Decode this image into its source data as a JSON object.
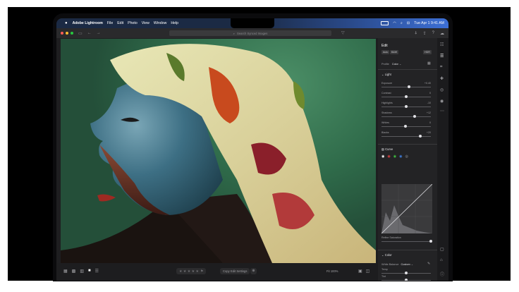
{
  "menubar": {
    "apple": "",
    "app_name": "Adobe Lightroom",
    "items": [
      "File",
      "Edit",
      "Photo",
      "View",
      "Window",
      "Help"
    ],
    "clock": "Tue Apr 1  9:41 AM"
  },
  "toolbar": {
    "search_placeholder": "Search Synced Images"
  },
  "bottombar": {
    "stars": "★ ★ ★ ★ ★",
    "copy_label": "Copy Edit Settings",
    "fit_label": "Fit 100%"
  },
  "panel": {
    "title": "Edit",
    "auto_label": "Auto",
    "bw_label": "B&W",
    "hdr_label": "HDR",
    "profile_label": "Profile",
    "profile_value": "Color",
    "light": {
      "title": "Light",
      "sliders": [
        {
          "label": "Exposure",
          "value": "+0.40",
          "pos": 0.55
        },
        {
          "label": "Contrast",
          "value": "0",
          "pos": 0.5
        },
        {
          "label": "Highlights",
          "value": "-10",
          "pos": 0.5
        },
        {
          "label": "Shadows",
          "value": "+12",
          "pos": 0.67
        },
        {
          "label": "Whites",
          "value": "0",
          "pos": 0.48
        },
        {
          "label": "Blacks",
          "value": "+20",
          "pos": 0.78
        }
      ]
    },
    "curve": {
      "title": "Curve",
      "refine_label": "Refine Saturation",
      "refine_pos": 1.0
    },
    "color": {
      "title": "Color",
      "wb_label": "White Balance",
      "wb_value": "Custom",
      "temp_label": "Temp",
      "temp_pos": 0.5,
      "tint_label": "Tint",
      "tint_pos": 0.5
    }
  },
  "colors": {
    "accent": "#3c6fd6",
    "panel_bg": "#232325",
    "photo_bg": "#2f6b4a"
  }
}
